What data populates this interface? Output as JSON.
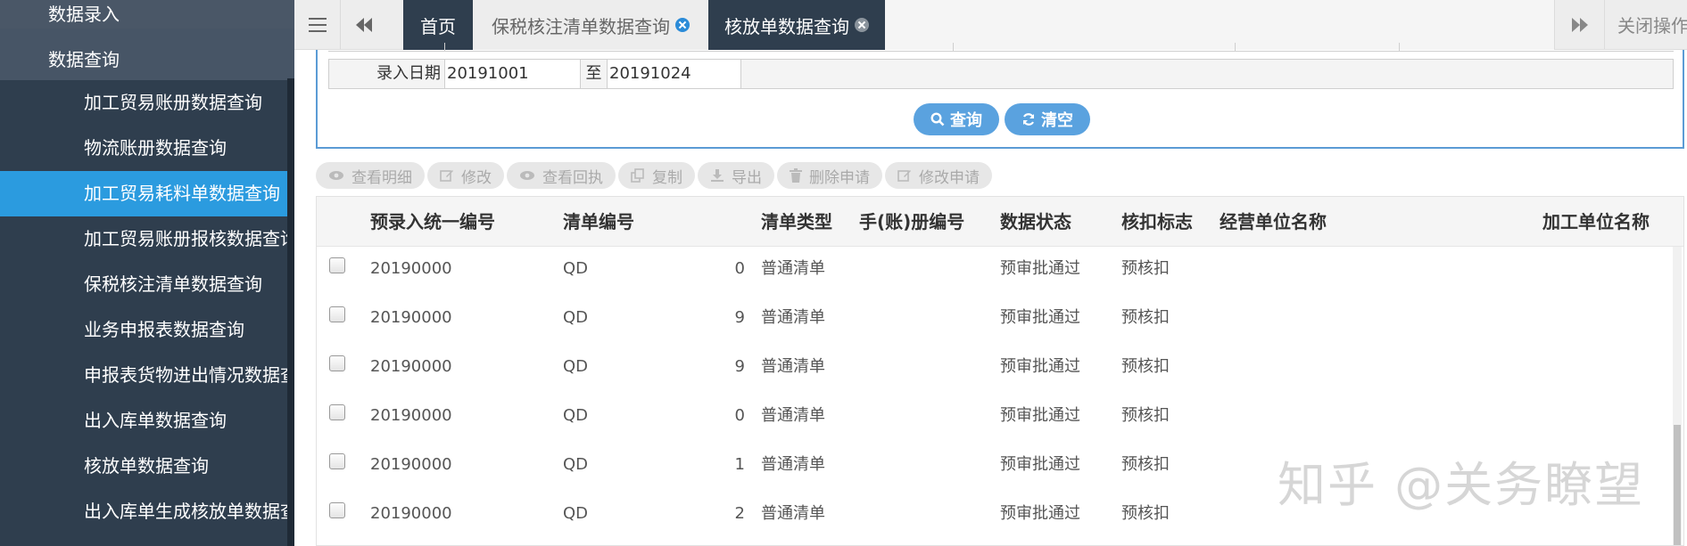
{
  "sidebar": {
    "group_entry": "数据录入",
    "group_query": "数据查询",
    "items": [
      {
        "label": "加工贸易账册数据查询"
      },
      {
        "label": "物流账册数据查询"
      },
      {
        "label": "加工贸易耗料单数据查询"
      },
      {
        "label": "加工贸易账册报核数据查询"
      },
      {
        "label": "保税核注清单数据查询"
      },
      {
        "label": "业务申报表数据查询"
      },
      {
        "label": "申报表货物进出情况数据查询"
      },
      {
        "label": "出入库单数据查询"
      },
      {
        "label": "核放单数据查询"
      },
      {
        "label": "出入库单生成核放单数据查询"
      }
    ],
    "active_index": 2
  },
  "tabs": {
    "home": "首页",
    "tab2": "保税核注清单数据查询",
    "tab3": "核放单数据查询",
    "close_ops": "关闭操作"
  },
  "query": {
    "date_label": "录入日期",
    "date_from": "20191001",
    "to_label": "至",
    "date_to": "20191024",
    "search_btn": "查询",
    "clear_btn": "清空"
  },
  "toolbar": {
    "view_detail": "查看明细",
    "edit": "修改",
    "view_receipt": "查看回执",
    "copy": "复制",
    "export": "导出",
    "delete_request": "删除申请",
    "modify_request": "修改申请"
  },
  "table": {
    "columns": [
      "预录入统一编号",
      "清单编号",
      "清单类型",
      "手(账)册编号",
      "数据状态",
      "核扣标志",
      "经营单位名称",
      "加工单位名称"
    ],
    "rows": [
      {
        "pre_id": "20190000",
        "list_no_prefix": "QD",
        "list_no_suffix": "0",
        "type": "普通清单",
        "book_no": "",
        "status": "预审批通过",
        "deduct": "预核扣"
      },
      {
        "pre_id": "20190000",
        "list_no_prefix": "QD",
        "list_no_suffix": "9",
        "type": "普通清单",
        "book_no": "",
        "status": "预审批通过",
        "deduct": "预核扣"
      },
      {
        "pre_id": "20190000",
        "list_no_prefix": "QD",
        "list_no_suffix": "9",
        "type": "普通清单",
        "book_no": "",
        "status": "预审批通过",
        "deduct": "预核扣"
      },
      {
        "pre_id": "20190000",
        "list_no_prefix": "QD",
        "list_no_suffix": "0",
        "type": "普通清单",
        "book_no": "",
        "status": "预审批通过",
        "deduct": "预核扣"
      },
      {
        "pre_id": "20190000",
        "list_no_prefix": "QD",
        "list_no_suffix": "1",
        "type": "普通清单",
        "book_no": "",
        "status": "预审批通过",
        "deduct": "预核扣"
      },
      {
        "pre_id": "20190000",
        "list_no_prefix": "QD",
        "list_no_suffix": "2",
        "type": "普通清单",
        "book_no": "",
        "status": "预审批通过",
        "deduct": "预核扣"
      }
    ]
  },
  "watermark": "知乎 @关务瞭望",
  "colors": {
    "sidebar_bg": "#2f3e4e",
    "active_item": "#2b9bdf",
    "accent": "#5aa2df",
    "panel_border": "#5b9bd5"
  },
  "icons": [
    "menu-icon",
    "double-chevron-left-icon",
    "double-chevron-right-icon",
    "close-circle-icon",
    "search-icon",
    "refresh-icon",
    "eye-icon",
    "edit-icon",
    "copy-icon",
    "download-icon",
    "trash-icon"
  ]
}
